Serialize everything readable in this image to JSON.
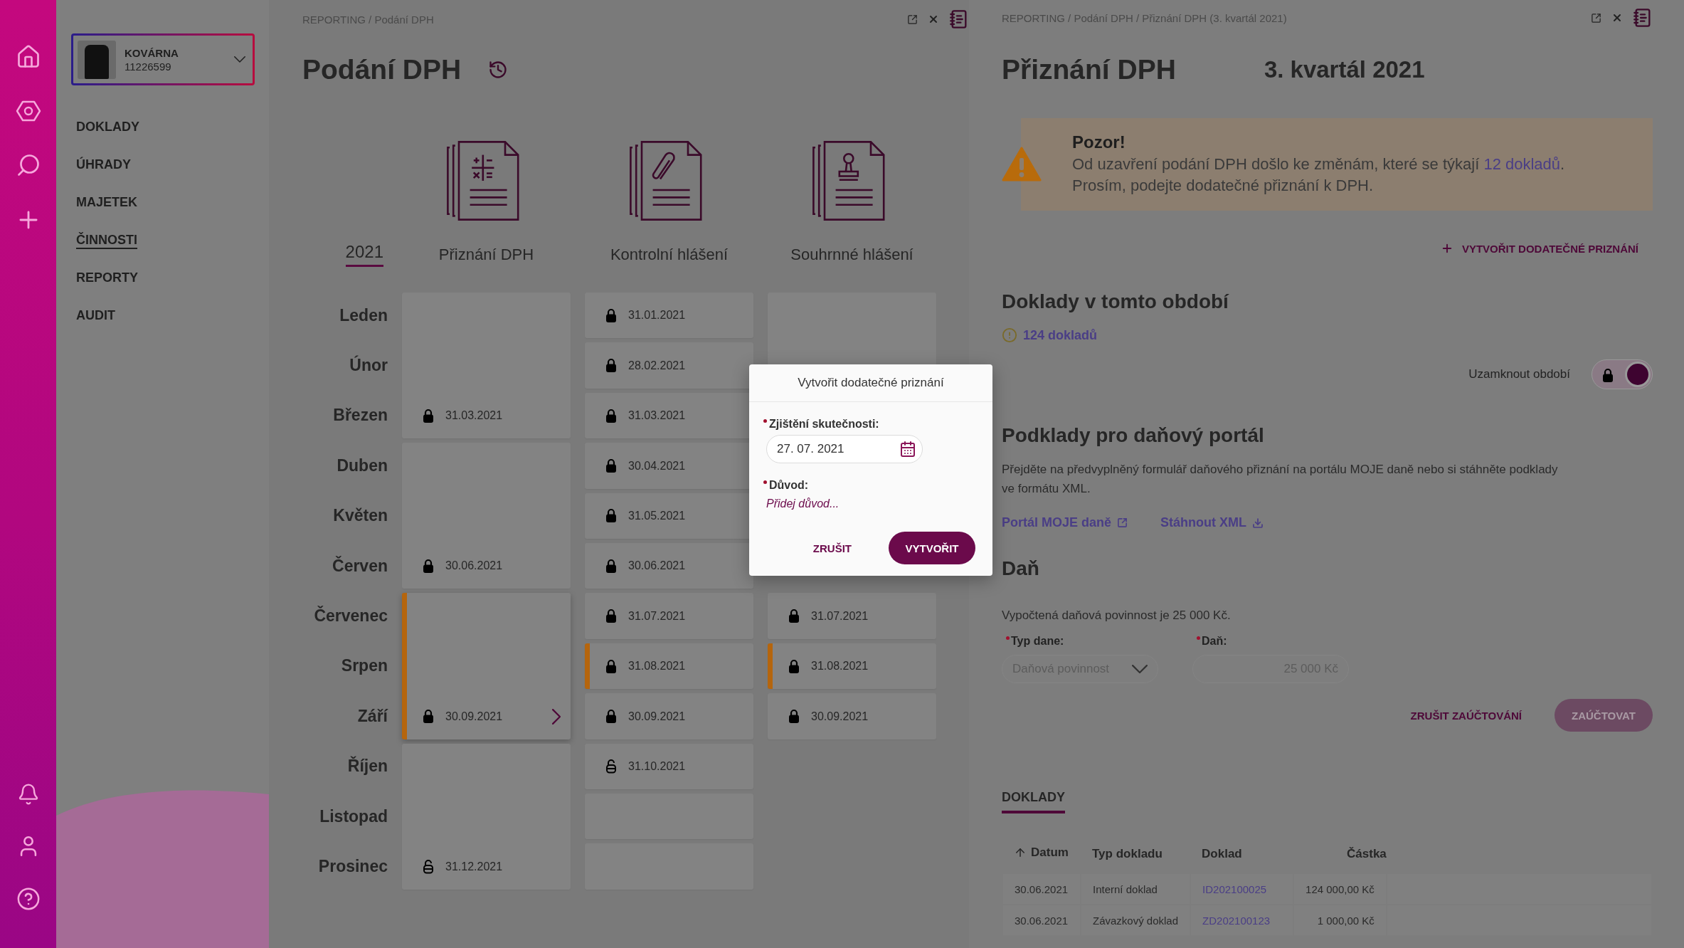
{
  "company": {
    "name": "KOVÁRNA",
    "id": "11226599"
  },
  "nav": [
    {
      "label": "DOKLADY",
      "selected": false
    },
    {
      "label": "ÚHRADY",
      "selected": false
    },
    {
      "label": "MAJETEK",
      "selected": false
    },
    {
      "label": "ČINNOSTI",
      "selected": true
    },
    {
      "label": "REPORTY",
      "selected": false
    },
    {
      "label": "AUDIT",
      "selected": false
    }
  ],
  "filings": {
    "breadcrumb": "REPORTING / Podání DPH",
    "title": "Podání DPH",
    "years": [
      {
        "label": "2021",
        "selected": true
      }
    ],
    "months": [
      "Leden",
      "Únor",
      "Březen",
      "Duben",
      "Květen",
      "Červen",
      "Červenec",
      "Srpen",
      "Září",
      "Říjen",
      "Listopad",
      "Prosinec"
    ],
    "columns": [
      {
        "label": "Přiznání DPH",
        "cards": [
          {
            "kind": "quarter",
            "date": "31.03.2021",
            "locked": true,
            "selected": false,
            "flagged": false
          },
          {
            "kind": "quarter",
            "date": "30.06.2021",
            "locked": true,
            "selected": false,
            "flagged": false
          },
          {
            "kind": "quarter",
            "date": "30.09.2021",
            "locked": true,
            "selected": true,
            "flagged": true
          },
          {
            "kind": "quarter",
            "date": "31.12.2021",
            "locked": false,
            "selected": false,
            "flagged": false
          }
        ]
      },
      {
        "label": "Kontrolní hlášení",
        "cards": [
          {
            "kind": "month",
            "date": "31.01.2021",
            "locked": true,
            "selected": false,
            "flagged": false
          },
          {
            "kind": "month",
            "date": "28.02.2021",
            "locked": true,
            "selected": false,
            "flagged": false
          },
          {
            "kind": "month",
            "date": "31.03.2021",
            "locked": true,
            "selected": false,
            "flagged": false
          },
          {
            "kind": "month",
            "date": "30.04.2021",
            "locked": true,
            "selected": false,
            "flagged": false
          },
          {
            "kind": "month",
            "date": "31.05.2021",
            "locked": true,
            "selected": false,
            "flagged": false
          },
          {
            "kind": "month",
            "date": "30.06.2021",
            "locked": true,
            "selected": false,
            "flagged": false
          },
          {
            "kind": "month",
            "date": "31.07.2021",
            "locked": true,
            "selected": false,
            "flagged": false
          },
          {
            "kind": "month",
            "date": "31.08.2021",
            "locked": true,
            "selected": false,
            "flagged": true
          },
          {
            "kind": "month",
            "date": "30.09.2021",
            "locked": true,
            "selected": false,
            "flagged": false
          },
          {
            "kind": "month",
            "date": "31.10.2021",
            "locked": false,
            "selected": false,
            "flagged": false
          },
          {
            "kind": "month",
            "selected": false,
            "flagged": false
          },
          {
            "kind": "month",
            "selected": false,
            "flagged": false
          }
        ]
      },
      {
        "label": "Souhrnné hlášení",
        "cards": [
          {
            "kind": "quarter",
            "selected": false,
            "flagged": false
          },
          {
            "kind": "gap"
          },
          {
            "kind": "month",
            "date": "31.07.2021",
            "locked": true,
            "selected": false,
            "flagged": false
          },
          {
            "kind": "month",
            "date": "31.08.2021",
            "locked": true,
            "selected": false,
            "flagged": true
          },
          {
            "kind": "month",
            "date": "30.09.2021",
            "locked": true,
            "selected": false,
            "flagged": false
          }
        ]
      }
    ]
  },
  "detail": {
    "breadcrumb": "REPORTING / Podání DPH / Přiznání DPH (3. kvartál 2021)",
    "title": "Přiznání DPH",
    "period": "3. kvartál 2021",
    "alert": {
      "title": "Pozor!",
      "before": "Od uzavření podání DPH došlo ke změnám, které se týkají ",
      "link": "12 dokladů",
      "after": ".",
      "line_2": "Prosím, podejte dodatečné přiznání k DPH."
    },
    "create_button": "VYTVOŘIT DODATEČNÉ PRIZNÁNÍ",
    "documents_heading": "Doklady v tomto období",
    "documents_link": "124 dokladů",
    "lock_toggle": {
      "label": "Uzamknout období",
      "on": true
    },
    "portal_heading": "Podklady pro daňový portál",
    "portal_text": "Přejděte na předvyplněný formulář daňového přiznání na portálu MOJE daně nebo si stáhněte podklady ve formátu XML.",
    "portal_links": [
      {
        "label": "Portál MOJE daně",
        "kind": "external"
      },
      {
        "label": "Stáhnout XML",
        "kind": "download"
      }
    ],
    "tax_heading": "Daň",
    "tax_text": "Vypočtená daňová povinnost je 25 000 Kč.",
    "tax_type": {
      "label": "Typ dane:",
      "value": "Daňová povinnost",
      "disabled": true
    },
    "tax_amount": {
      "label": "Daň:",
      "value": "25 000 Kč",
      "disabled": true
    },
    "cancel_button": "ZRUŠIT ZAÚČTOVÁNÍ",
    "post_button": {
      "label": "ZAÚČTOVAT",
      "disabled": true
    },
    "tabs": [
      {
        "label": "DOKLADY",
        "selected": true
      }
    ],
    "table": {
      "columns": [
        {
          "label": "Datum",
          "sort_ascending": true
        },
        {
          "label": "Typ dokladu"
        },
        {
          "label": "Doklad"
        },
        {
          "label": "Částka"
        }
      ],
      "rows": [
        [
          "30.06.2021",
          "Interní doklad",
          "ID202100025",
          "124 000,00 Kč"
        ],
        [
          "30.06.2021",
          "Závazkový doklad",
          "ZD202100123",
          "1 000,00 Kč"
        ]
      ]
    }
  },
  "dialog": {
    "title": "Vytvořit dodatečné priznání",
    "date_field": {
      "label": "Zjištění skutečnosti:",
      "value": "27. 07. 2021"
    },
    "reason_field": {
      "label": "Důvod:",
      "placeholder": "Přidej důvod..."
    },
    "cancel": "ZRUŠIT",
    "confirm": "VYTVOŘIT"
  }
}
